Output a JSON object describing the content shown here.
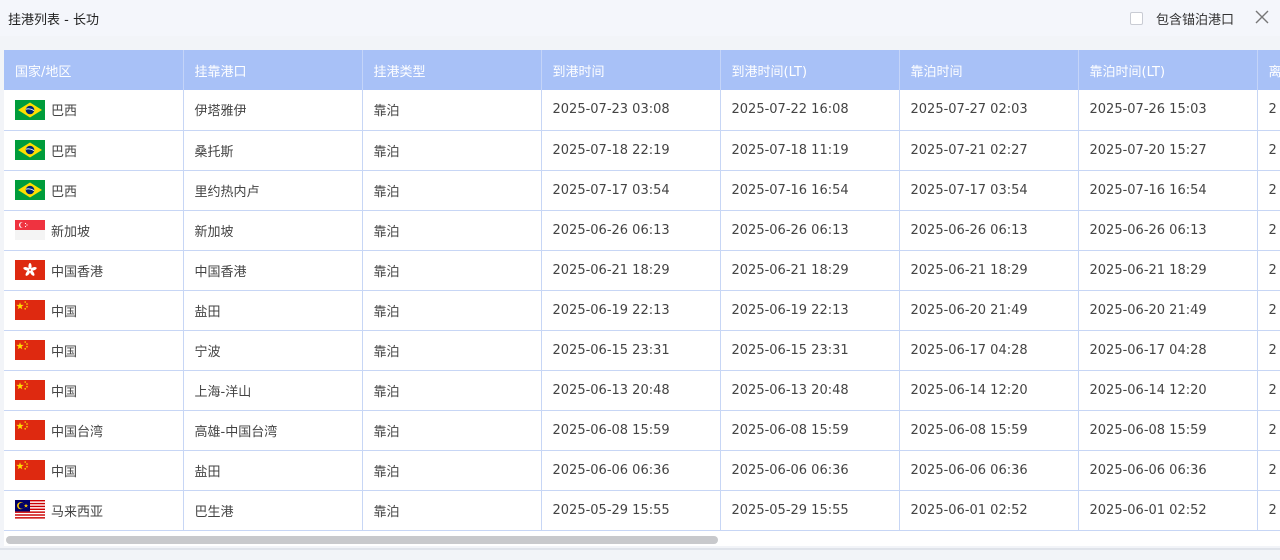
{
  "header": {
    "title": "挂港列表 - 长功",
    "anchor_option_label": "包含锚泊港口",
    "anchor_option_checked": false
  },
  "table": {
    "columns": [
      "国家/地区",
      "挂靠港口",
      "挂港类型",
      "到港时间",
      "到港时间(LT)",
      "靠泊时间",
      "靠泊时间(LT)",
      "离"
    ],
    "rows": [
      {
        "flag": "brazil-flag-icon",
        "country": "巴西",
        "port": "伊塔雅伊",
        "type": "靠泊",
        "arrival": "2025-07-23 03:08",
        "arrival_lt": "2025-07-22 16:08",
        "berth": "2025-07-27 02:03",
        "berth_lt": "2025-07-26 15:03",
        "next": "2"
      },
      {
        "flag": "brazil-flag-icon",
        "country": "巴西",
        "port": "桑托斯",
        "type": "靠泊",
        "arrival": "2025-07-18 22:19",
        "arrival_lt": "2025-07-18 11:19",
        "berth": "2025-07-21 02:27",
        "berth_lt": "2025-07-20 15:27",
        "next": "2"
      },
      {
        "flag": "brazil-flag-icon",
        "country": "巴西",
        "port": "里约热内卢",
        "type": "靠泊",
        "arrival": "2025-07-17 03:54",
        "arrival_lt": "2025-07-16 16:54",
        "berth": "2025-07-17 03:54",
        "berth_lt": "2025-07-16 16:54",
        "next": "2"
      },
      {
        "flag": "singapore-flag-icon",
        "country": "新加坡",
        "port": "新加坡",
        "type": "靠泊",
        "arrival": "2025-06-26 06:13",
        "arrival_lt": "2025-06-26 06:13",
        "berth": "2025-06-26 06:13",
        "berth_lt": "2025-06-26 06:13",
        "next": "2"
      },
      {
        "flag": "hongkong-flag-icon",
        "country": "中国香港",
        "port": "中国香港",
        "type": "靠泊",
        "arrival": "2025-06-21 18:29",
        "arrival_lt": "2025-06-21 18:29",
        "berth": "2025-06-21 18:29",
        "berth_lt": "2025-06-21 18:29",
        "next": "2"
      },
      {
        "flag": "china-flag-icon",
        "country": "中国",
        "port": "盐田",
        "type": "靠泊",
        "arrival": "2025-06-19 22:13",
        "arrival_lt": "2025-06-19 22:13",
        "berth": "2025-06-20 21:49",
        "berth_lt": "2025-06-20 21:49",
        "next": "2"
      },
      {
        "flag": "china-flag-icon",
        "country": "中国",
        "port": "宁波",
        "type": "靠泊",
        "arrival": "2025-06-15 23:31",
        "arrival_lt": "2025-06-15 23:31",
        "berth": "2025-06-17 04:28",
        "berth_lt": "2025-06-17 04:28",
        "next": "2"
      },
      {
        "flag": "china-flag-icon",
        "country": "中国",
        "port": "上海-洋山",
        "type": "靠泊",
        "arrival": "2025-06-13 20:48",
        "arrival_lt": "2025-06-13 20:48",
        "berth": "2025-06-14 12:20",
        "berth_lt": "2025-06-14 12:20",
        "next": "2"
      },
      {
        "flag": "china-flag-icon",
        "country": "中国台湾",
        "port": "高雄-中国台湾",
        "type": "靠泊",
        "arrival": "2025-06-08 15:59",
        "arrival_lt": "2025-06-08 15:59",
        "berth": "2025-06-08 15:59",
        "berth_lt": "2025-06-08 15:59",
        "next": "2"
      },
      {
        "flag": "china-flag-icon",
        "country": "中国",
        "port": "盐田",
        "type": "靠泊",
        "arrival": "2025-06-06 06:36",
        "arrival_lt": "2025-06-06 06:36",
        "berth": "2025-06-06 06:36",
        "berth_lt": "2025-06-06 06:36",
        "next": "2"
      },
      {
        "flag": "malaysia-flag-icon",
        "country": "马来西亚",
        "port": "巴生港",
        "type": "靠泊",
        "arrival": "2025-05-29 15:55",
        "arrival_lt": "2025-05-29 15:55",
        "berth": "2025-06-01 02:52",
        "berth_lt": "2025-06-01 02:52",
        "next": "2"
      }
    ]
  },
  "scrollbar": {
    "visible_fraction": 0.56,
    "scroll_fraction": 0
  },
  "colors": {
    "header_bg": "#a8c1f7",
    "border": "#c7d6f5",
    "text": "#444444"
  }
}
